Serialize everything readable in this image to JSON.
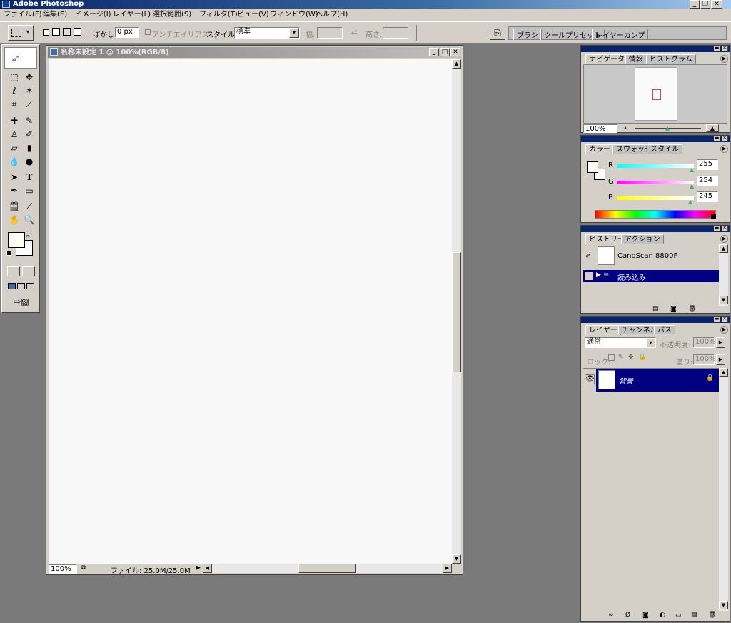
{
  "app": {
    "title": "Adobe Photoshop",
    "window_buttons": [
      "_",
      "❐",
      "✕"
    ]
  },
  "menubar": {
    "items": [
      "ファイル(F)",
      "編集(E)",
      "イメージ(I)",
      "レイヤー(L)",
      "選択範囲(S)",
      "フィルタ(T)",
      "ビュー(V)",
      "ウィンドウ(W)",
      "ヘルプ(H)"
    ]
  },
  "options": {
    "feather_label": "ぼかし:",
    "feather_value": "0 px",
    "antialias_label": "アンチエイリアス",
    "style_label": "スタイル:",
    "style_value": "標準",
    "width_label": "幅:",
    "height_label": "高さ:",
    "well_tabs": [
      "ブラシ",
      "ツールプリセット",
      "レイヤーカンプ"
    ]
  },
  "document": {
    "title": "名称未設定 1 @ 100%(RGB/8)",
    "zoom": "100%",
    "file_info": "ファイル: 25.0M/25.0M"
  },
  "navigator": {
    "tabs": [
      "ナビゲータ",
      "情報",
      "ヒストグラム"
    ],
    "zoom": "100%"
  },
  "color": {
    "tabs": [
      "カラー",
      "スウォッチ",
      "スタイル"
    ],
    "channels": [
      {
        "label": "R",
        "value": "255",
        "gradient": "#00ffff"
      },
      {
        "label": "G",
        "value": "254",
        "gradient": "#ff00ff"
      },
      {
        "label": "B",
        "value": "245",
        "gradient": "#ffff00"
      }
    ]
  },
  "history": {
    "tabs": [
      "ヒストリー",
      "アクション"
    ],
    "snapshot": "CanoScan 8800F",
    "state": "読み込み"
  },
  "layers": {
    "tabs": [
      "レイヤー",
      "チャンネル",
      "パス"
    ],
    "blend_mode": "通常",
    "opacity_label": "不透明度:",
    "opacity_value": "100%",
    "lock_label": "ロック:",
    "fill_label": "塗り:",
    "fill_value": "100%",
    "layer_name": "背景"
  },
  "colors": {
    "title_active": "#0a246a",
    "title_inactive": "#808080",
    "chrome": "#d4d0c8",
    "workspace": "#7a7a7a",
    "selection": "#000080",
    "foreground_swatch": "#fffef5",
    "background_swatch": "#ffffff"
  }
}
